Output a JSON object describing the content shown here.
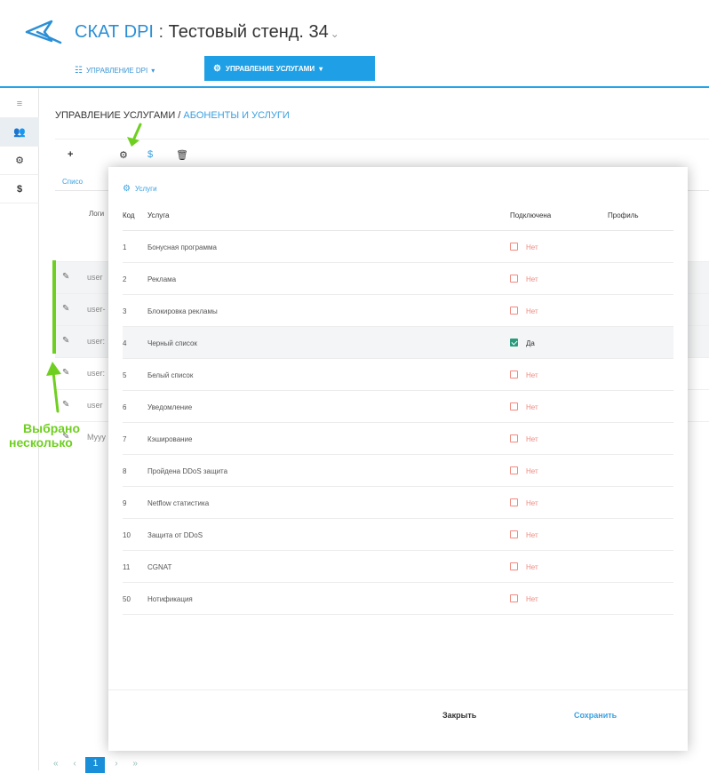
{
  "header": {
    "app_name": "СКАТ DPI",
    "separator": " : ",
    "stand": "Тестовый стенд. 34",
    "nav_dpi": "УПРАВЛЕНИЕ DPI",
    "nav_services": "УПРАВЛЕНИЕ УСЛУГАМИ"
  },
  "breadcrumb": {
    "root": "УПРАВЛЕНИЕ УСЛУГАМИ",
    "sep": " / ",
    "current": "АБОНЕНТЫ И УСЛУГИ"
  },
  "background": {
    "tab_label": "Списо",
    "column_login": "Логи",
    "rows": [
      "user",
      "user-",
      "user:",
      "user:",
      "user",
      "Myyy"
    ]
  },
  "annotation": {
    "line1": "Выбрано",
    "line2": "несколько"
  },
  "modal": {
    "title": "Услуги",
    "headers": {
      "code": "Код",
      "service": "Услуга",
      "connected": "Подключена",
      "profile": "Профиль"
    },
    "rows": [
      {
        "code": "1",
        "service": "Бонусная программа",
        "status": "Нет",
        "checked": false
      },
      {
        "code": "2",
        "service": "Реклама",
        "status": "Нет",
        "checked": false
      },
      {
        "code": "3",
        "service": "Блокировка рекламы",
        "status": "Нет",
        "checked": false
      },
      {
        "code": "4",
        "service": "Черный список",
        "status": "Да",
        "checked": true
      },
      {
        "code": "5",
        "service": "Белый список",
        "status": "Нет",
        "checked": false
      },
      {
        "code": "6",
        "service": "Уведомление",
        "status": "Нет",
        "checked": false
      },
      {
        "code": "7",
        "service": "Кэширование",
        "status": "Нет",
        "checked": false
      },
      {
        "code": "8",
        "service": "Пройдена DDoS защита",
        "status": "Нет",
        "checked": false
      },
      {
        "code": "9",
        "service": "Netflow статистика",
        "status": "Нет",
        "checked": false
      },
      {
        "code": "10",
        "service": "Защита от DDoS",
        "status": "Нет",
        "checked": false
      },
      {
        "code": "11",
        "service": "CGNAT",
        "status": "Нет",
        "checked": false
      },
      {
        "code": "50",
        "service": "Нотификация",
        "status": "Нет",
        "checked": false
      }
    ],
    "close_label": "Закрыть",
    "save_label": "Сохранить"
  },
  "pager": {
    "first": "«",
    "prev": "‹",
    "current": "1",
    "next": "›",
    "last": "»"
  },
  "colors": {
    "accent": "#1fa0e6",
    "annotation": "#6fcf20",
    "no": "#f08a80",
    "checked": "#2a9a7c"
  }
}
